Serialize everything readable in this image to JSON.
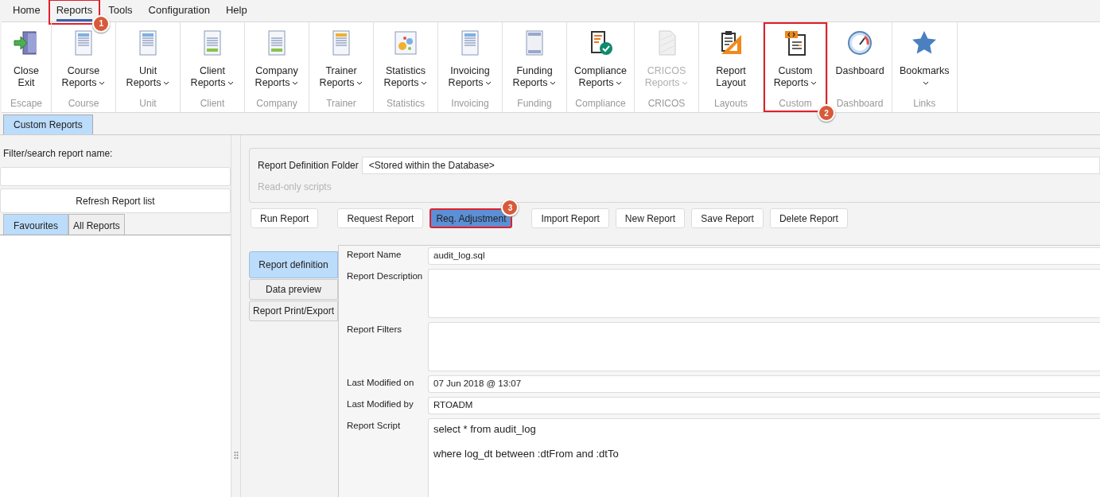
{
  "menu": [
    {
      "label": "Home",
      "selected": false
    },
    {
      "label": "Reports",
      "selected": true,
      "annotation": "1"
    },
    {
      "label": "Tools",
      "selected": false
    },
    {
      "label": "Configuration",
      "selected": false
    },
    {
      "label": "Help",
      "selected": false
    }
  ],
  "ribbon": [
    {
      "lines": [
        "Close",
        "Exit"
      ],
      "dropdown": false,
      "disabled": false,
      "caption": "Escape"
    },
    {
      "lines": [
        "Course",
        "Reports"
      ],
      "dropdown": true,
      "disabled": false,
      "caption": "Course"
    },
    {
      "lines": [
        "Unit",
        "Reports"
      ],
      "dropdown": true,
      "disabled": false,
      "caption": "Unit"
    },
    {
      "lines": [
        "Client",
        "Reports"
      ],
      "dropdown": true,
      "disabled": false,
      "caption": "Client"
    },
    {
      "lines": [
        "Company",
        "Reports"
      ],
      "dropdown": true,
      "disabled": false,
      "caption": "Company"
    },
    {
      "lines": [
        "Trainer",
        "Reports"
      ],
      "dropdown": true,
      "disabled": false,
      "caption": "Trainer"
    },
    {
      "lines": [
        "Statistics",
        "Reports"
      ],
      "dropdown": true,
      "disabled": false,
      "caption": "Statistics"
    },
    {
      "lines": [
        "Invoicing",
        "Reports"
      ],
      "dropdown": true,
      "disabled": false,
      "caption": "Invoicing"
    },
    {
      "lines": [
        "Funding",
        "Reports"
      ],
      "dropdown": true,
      "disabled": false,
      "caption": "Funding"
    },
    {
      "lines": [
        "Compliance",
        "Reports"
      ],
      "dropdown": true,
      "disabled": false,
      "caption": "Compliance"
    },
    {
      "lines": [
        "CRICOS",
        "Reports"
      ],
      "dropdown": true,
      "disabled": true,
      "caption": "CRICOS"
    },
    {
      "lines": [
        "Report",
        "Layout"
      ],
      "dropdown": false,
      "disabled": false,
      "caption": "Layouts"
    },
    {
      "lines": [
        "Custom",
        "Reports"
      ],
      "dropdown": true,
      "disabled": false,
      "caption": "Custom",
      "annotation": "2"
    },
    {
      "lines": [
        "Dashboard"
      ],
      "dropdown": false,
      "disabled": false,
      "caption": "Dashboard"
    },
    {
      "lines": [
        "Bookmarks"
      ],
      "dropdown": true,
      "disabled": false,
      "caption": "Links"
    }
  ],
  "document_tabs": [
    {
      "label": "Custom Reports",
      "selected": true
    }
  ],
  "left_panel": {
    "filter_label": "Filter/search report name:",
    "refresh_button": "Refresh Report list",
    "tabs": [
      {
        "label": "Favourites",
        "selected": true
      },
      {
        "label": "All Reports",
        "selected": false
      }
    ]
  },
  "folder": {
    "label": "Report Definition Folder",
    "value": "<Stored within the Database>",
    "read_only_scripts": "Read-only scripts"
  },
  "buttons": [
    {
      "label": "Run Report"
    },
    {
      "label": "Request Report"
    },
    {
      "label": "Req. Adjustment",
      "annotation": "3"
    },
    {
      "label": "Import Report"
    },
    {
      "label": "New Report"
    },
    {
      "label": "Save Report"
    },
    {
      "label": "Delete Report"
    }
  ],
  "side_tabs": [
    {
      "label": "Report definition",
      "selected": true
    },
    {
      "label": "Data preview",
      "selected": false
    },
    {
      "label": "Report Print/Export",
      "selected": false
    }
  ],
  "fields": [
    {
      "label": "Report Name",
      "kind": "line",
      "value": "audit_log.sql"
    },
    {
      "label": "Report Description",
      "kind": "multiline"
    },
    {
      "label": "Report Filters",
      "kind": "multiline"
    },
    {
      "label": "Last Modified on",
      "kind": "line",
      "value": "07 Jun 2018 @ 13:07"
    },
    {
      "label": "Last Modified by",
      "kind": "line",
      "value": "RTOADM"
    },
    {
      "label": "Report Script",
      "kind": "script",
      "lines": [
        "select * from audit_log",
        "where log_dt between :dtFrom and :dtTo"
      ]
    }
  ]
}
